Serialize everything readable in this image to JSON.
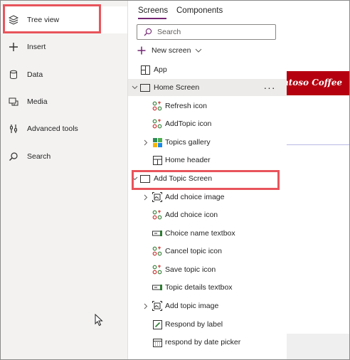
{
  "left_nav": {
    "items": [
      {
        "label": "Tree view",
        "icon": "layers-icon",
        "active": true
      },
      {
        "label": "Insert",
        "icon": "plus-icon",
        "active": false
      },
      {
        "label": "Data",
        "icon": "database-icon",
        "active": false
      },
      {
        "label": "Media",
        "icon": "media-icon",
        "active": false
      },
      {
        "label": "Advanced tools",
        "icon": "tools-icon",
        "active": false
      },
      {
        "label": "Search",
        "icon": "search-icon",
        "active": false
      }
    ]
  },
  "tree": {
    "tabs": [
      {
        "label": "Screens",
        "active": true
      },
      {
        "label": "Components",
        "active": false
      }
    ],
    "search_placeholder": "Search",
    "new_screen_label": "New screen",
    "app_label": "App",
    "rows": [
      {
        "label": "Home Screen",
        "icon": "screen-icon",
        "level": 0,
        "expanded": true,
        "selected": true
      },
      {
        "label": "Refresh icon",
        "icon": "shapes-icon",
        "level": 1
      },
      {
        "label": "AddTopic icon",
        "icon": "shapes-icon",
        "level": 1
      },
      {
        "label": "Topics gallery",
        "icon": "gallery-icon",
        "level": 1,
        "collapsed": true
      },
      {
        "label": "Home header",
        "icon": "header-icon",
        "level": 1
      },
      {
        "label": "Add Topic Screen",
        "icon": "screen-icon",
        "level": 0,
        "expanded": true
      },
      {
        "label": "Add choice image",
        "icon": "image-icon",
        "level": 1,
        "collapsed": true
      },
      {
        "label": "Add choice icon",
        "icon": "shapes-icon",
        "level": 1
      },
      {
        "label": "Choice name textbox",
        "icon": "textbox-icon",
        "level": 1
      },
      {
        "label": "Cancel topic icon",
        "icon": "shapes-icon",
        "level": 1
      },
      {
        "label": "Save topic icon",
        "icon": "shapes-icon",
        "level": 1
      },
      {
        "label": "Topic details textbox",
        "icon": "textbox-icon",
        "level": 1
      },
      {
        "label": "Add topic image",
        "icon": "image-icon",
        "level": 1,
        "collapsed": true
      },
      {
        "label": "Respond by label",
        "icon": "label-icon",
        "level": 1
      },
      {
        "label": "respond by date picker",
        "icon": "calendar-icon",
        "level": 1
      }
    ]
  },
  "canvas": {
    "banner_text": "ntoso Coffee"
  },
  "colors": {
    "accent": "#742774",
    "callout": "#e8545b",
    "banner": "#b5000f"
  }
}
